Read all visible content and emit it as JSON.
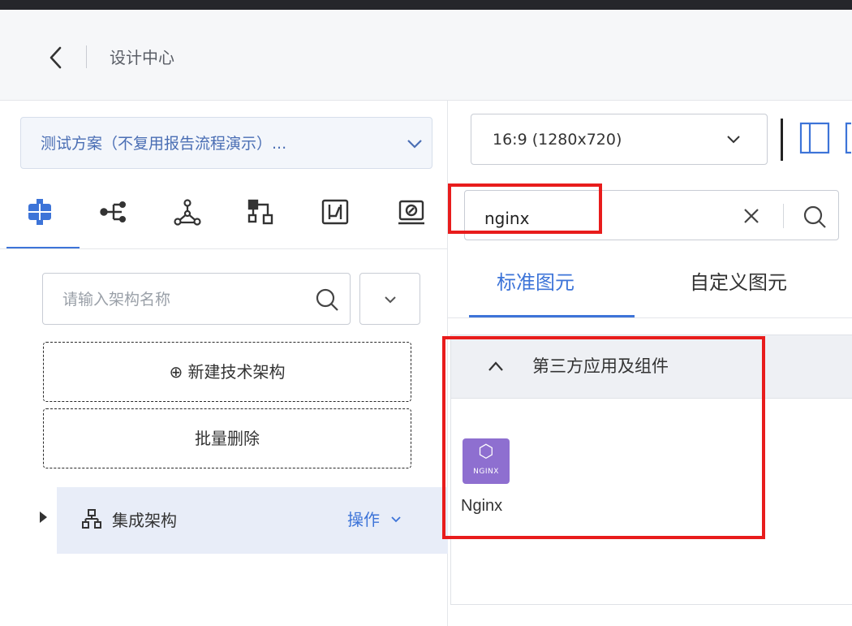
{
  "header": {
    "title": "设计中心"
  },
  "left_panel": {
    "plan_selector": {
      "value": "测试方案（不复用报告流程演示）..."
    },
    "tool_tabs": [
      {
        "icon": "architecture-icon",
        "active": true
      },
      {
        "icon": "branch-icon"
      },
      {
        "icon": "network-nodes-icon"
      },
      {
        "icon": "flow-blocks-icon"
      },
      {
        "icon": "sequence-diagram-icon"
      },
      {
        "icon": "deploy-diagram-icon"
      }
    ],
    "architecture_search": {
      "placeholder": "请输入架构名称",
      "value": ""
    },
    "new_architecture_button": "⊕ 新建技术架构",
    "batch_delete_button": "批量删除",
    "tree": [
      {
        "label": "集成架构",
        "action_label": "操作"
      }
    ]
  },
  "right_panel": {
    "ratio_select": {
      "value": "16:9 (1280x720)"
    },
    "component_search": {
      "value": "nginx",
      "placeholder": ""
    },
    "library_tabs": [
      {
        "label": "标准图元",
        "active": true
      },
      {
        "label": "自定义图元",
        "active": false
      }
    ],
    "group": {
      "title": "第三方应用及组件",
      "expanded": true,
      "components": [
        {
          "name": "Nginx",
          "logo_text": "NGINX",
          "logo_color": "#8e6fd0"
        }
      ]
    }
  },
  "colors": {
    "accent": "#3d74d8",
    "highlight": "#e81c1c",
    "topbar": "#25262b"
  }
}
